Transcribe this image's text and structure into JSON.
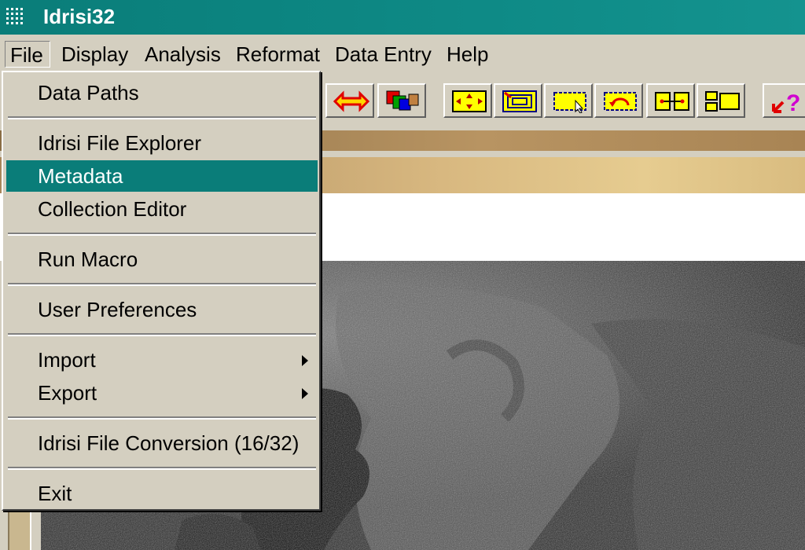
{
  "window": {
    "title": "Idrisi32"
  },
  "menubar": {
    "items": [
      {
        "label": "File"
      },
      {
        "label": "Display"
      },
      {
        "label": "Analysis"
      },
      {
        "label": "Reformat"
      },
      {
        "label": "Data Entry"
      },
      {
        "label": "Help"
      }
    ]
  },
  "file_menu": {
    "items": [
      {
        "label": "Data Paths"
      },
      {
        "label": "Idrisi File Explorer"
      },
      {
        "label": "Metadata",
        "selected": true
      },
      {
        "label": "Collection Editor"
      },
      {
        "label": "Run Macro"
      },
      {
        "label": "User Preferences"
      },
      {
        "label": "Import",
        "submenu": true
      },
      {
        "label": "Export",
        "submenu": true
      },
      {
        "label": "Idrisi File Conversion (16/32)"
      },
      {
        "label": "Exit"
      }
    ]
  },
  "toolbar": {
    "icons": [
      "pan-arrows-icon",
      "layer-stack-icon",
      "zoom-extent-icon",
      "composite-frames-icon",
      "zoom-window-icon",
      "restore-view-icon",
      "link-nodes-icon",
      "group-boxes-icon",
      "context-help-icon"
    ]
  },
  "colors": {
    "titlebar": "#0a7d79",
    "selection": "#0a7d79",
    "face": "#d4cfc0"
  }
}
